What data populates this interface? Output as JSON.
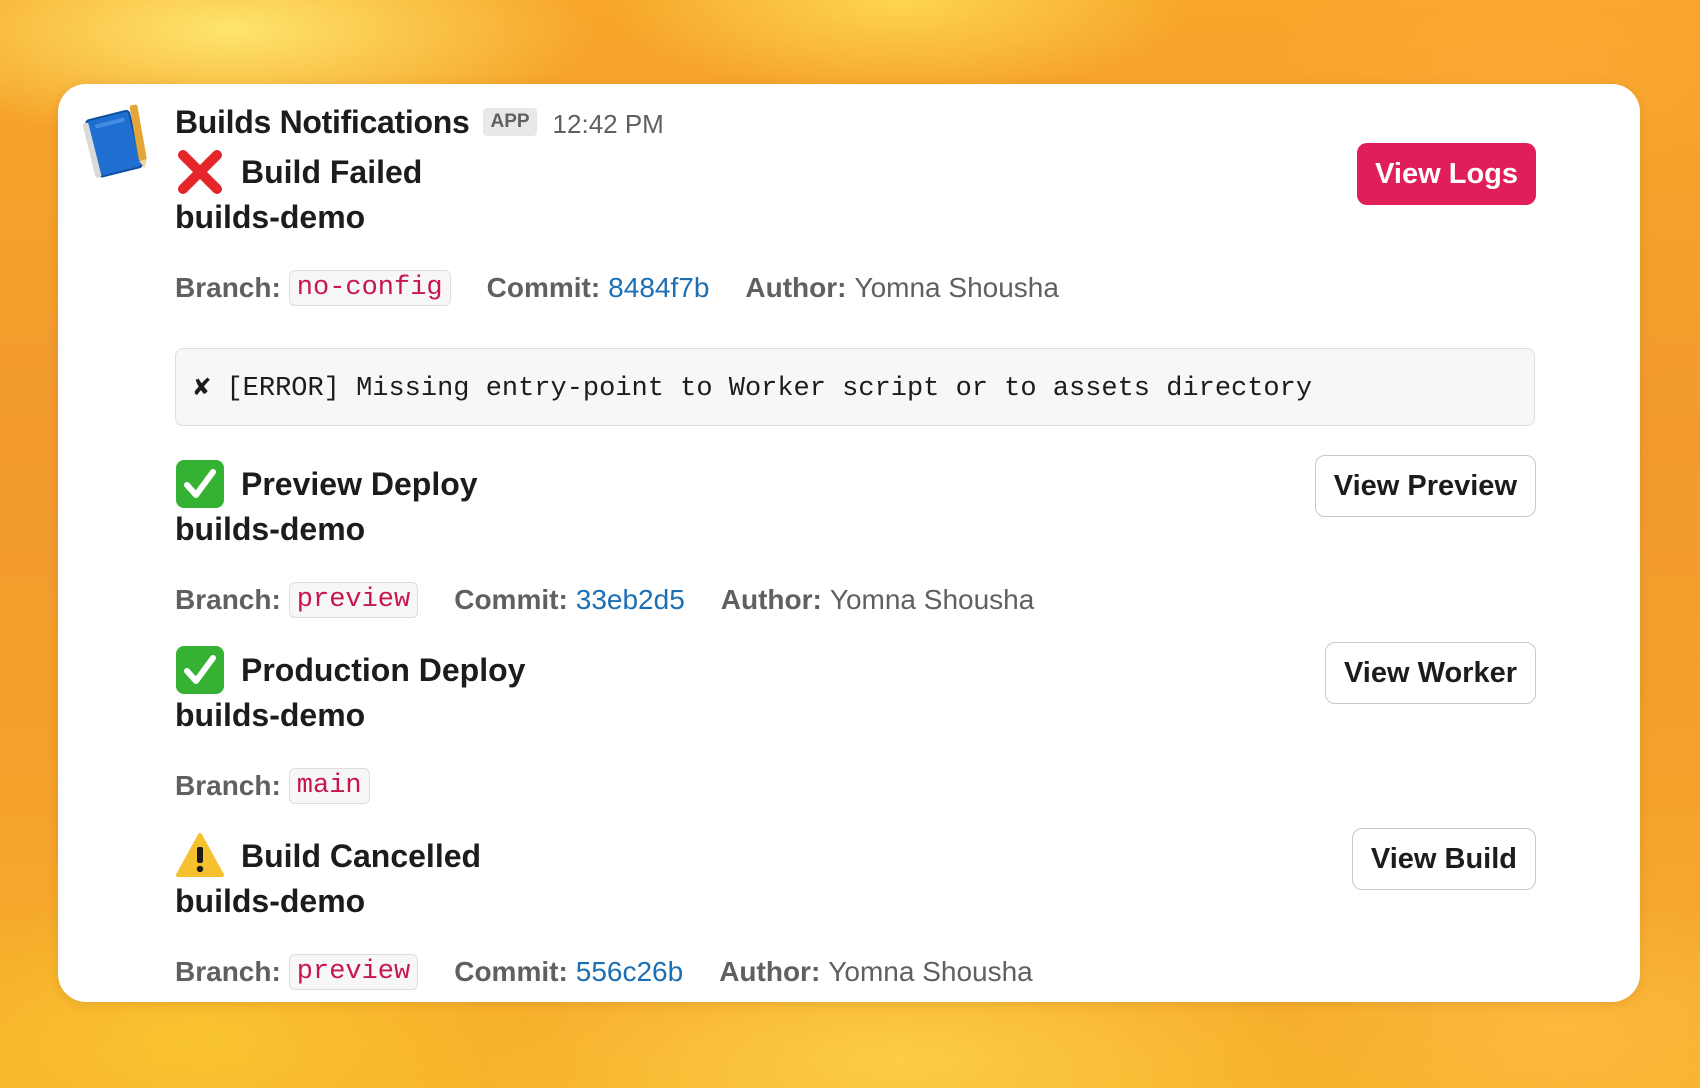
{
  "header": {
    "app_name": "Builds Notifications",
    "badge": "APP",
    "timestamp": "12:42 PM"
  },
  "blocks": [
    {
      "status": "failed",
      "status_icon": "cross-mark-icon",
      "title": "Build Failed",
      "project": "builds-demo",
      "branch_label": "Branch:",
      "branch": "no-config",
      "commit_label": "Commit:",
      "commit": "8484f7b",
      "author_label": "Author:",
      "author": "Yomna Shousha",
      "error": "✘ [ERROR] Missing entry-point to Worker script or to assets directory",
      "button": "View Logs"
    },
    {
      "status": "success",
      "status_icon": "check-mark-icon",
      "title": "Preview Deploy",
      "project": "builds-demo",
      "branch_label": "Branch:",
      "branch": "preview",
      "commit_label": "Commit:",
      "commit": "33eb2d5",
      "author_label": "Author:",
      "author": "Yomna Shousha",
      "button": "View Preview"
    },
    {
      "status": "success",
      "status_icon": "check-mark-icon",
      "title": "Production Deploy",
      "project": "builds-demo",
      "branch_label": "Branch:",
      "branch": "main",
      "button": "View Worker"
    },
    {
      "status": "cancelled",
      "status_icon": "warning-icon",
      "title": "Build Cancelled",
      "project": "builds-demo",
      "branch_label": "Branch:",
      "branch": "preview",
      "commit_label": "Commit:",
      "commit": "556c26b",
      "author_label": "Author:",
      "author": "Yomna Shousha",
      "button": "View Build"
    }
  ],
  "colors": {
    "danger_button": "#e01e5a",
    "link": "#1d6fb4",
    "code_text": "#c8174d",
    "success_green": "#35b233",
    "error_red": "#e5262b",
    "warning_yellow": "#f5c12e"
  }
}
